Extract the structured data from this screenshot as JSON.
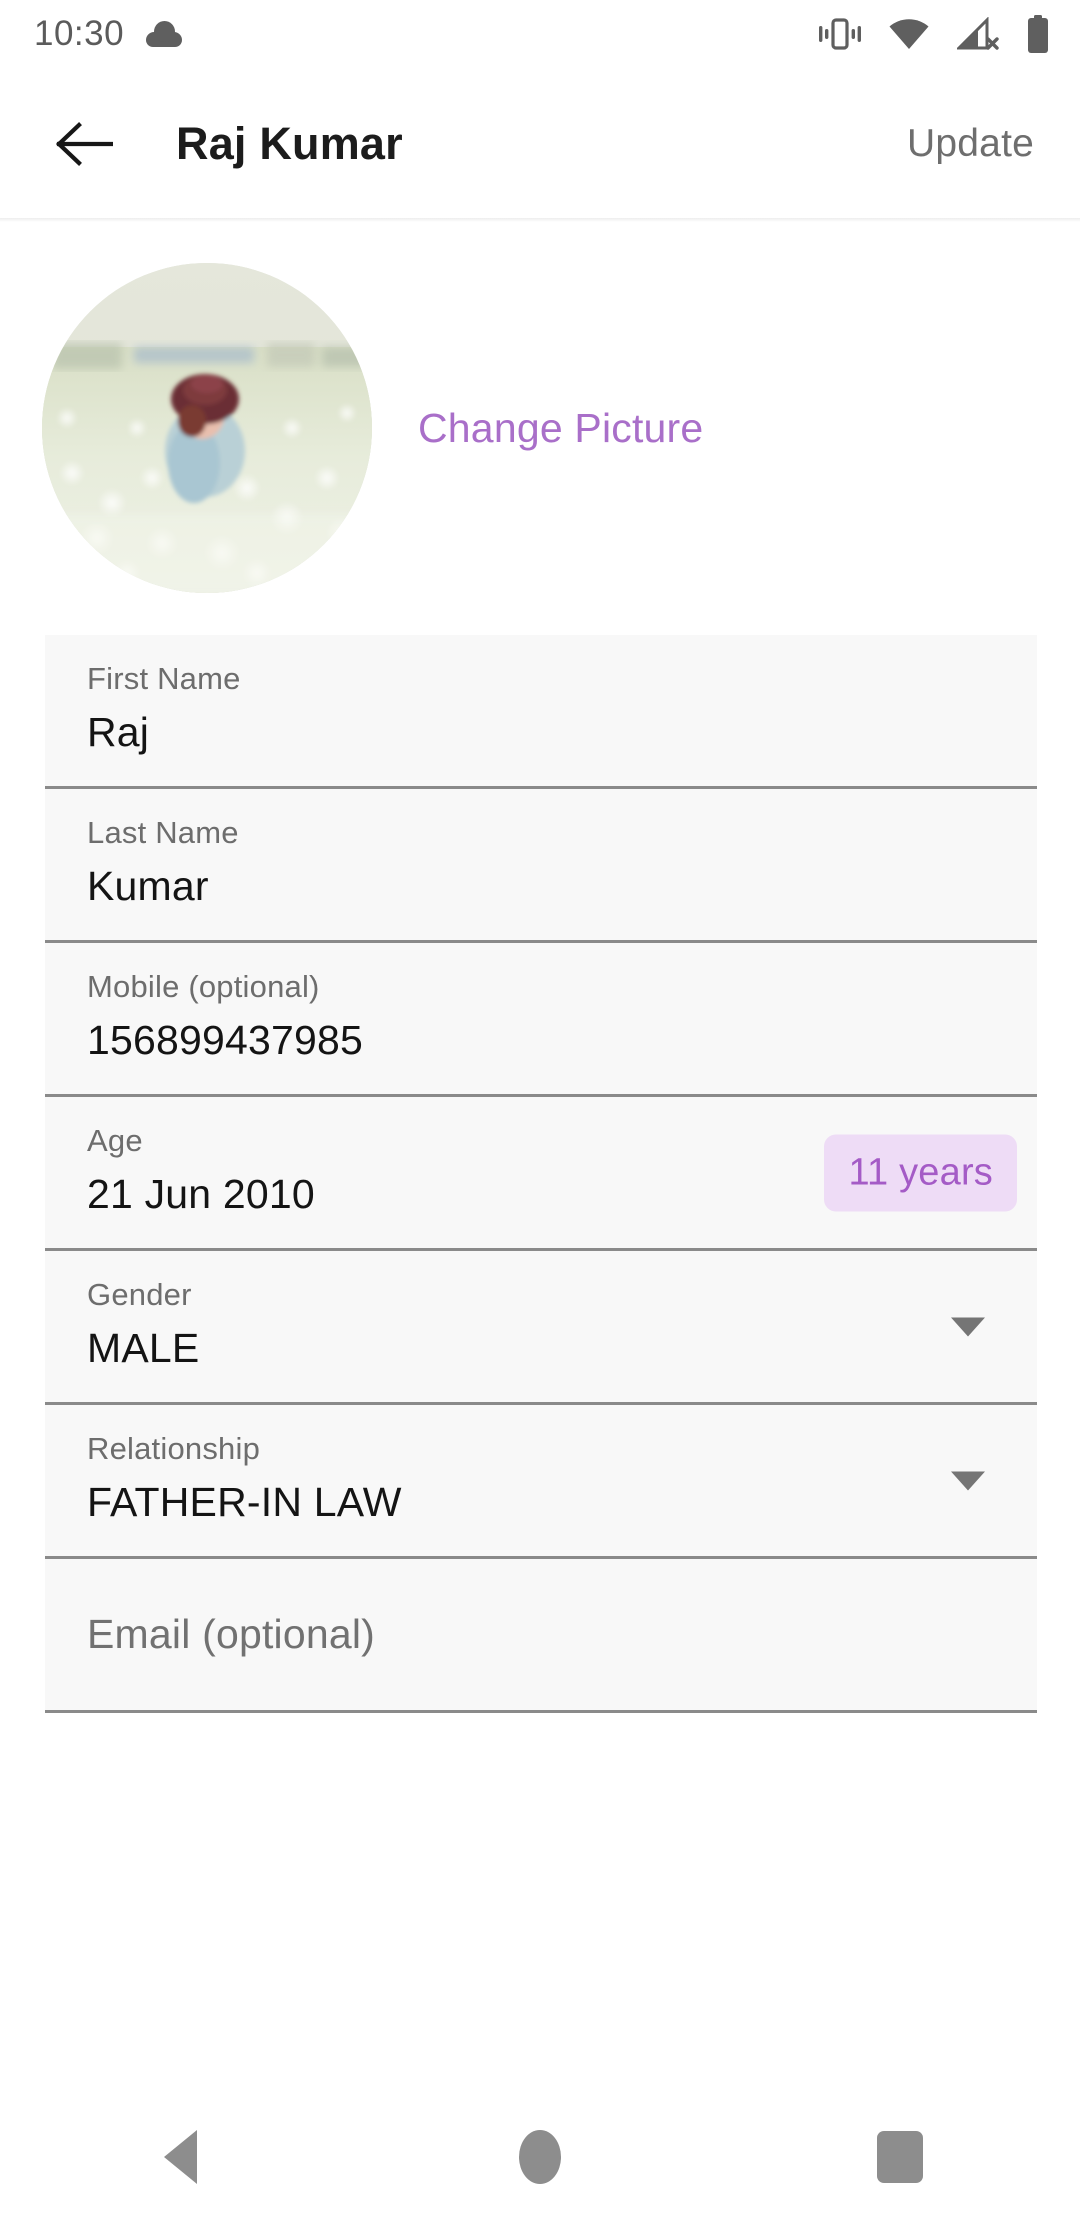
{
  "status_bar": {
    "time": "10:30",
    "left_icons": [
      "cloud-icon"
    ],
    "right_icons": [
      "vibrate-icon",
      "wifi-icon",
      "signal-no-service-icon",
      "battery-icon"
    ]
  },
  "appbar": {
    "back_icon": "arrow-left-icon",
    "title": "Raj Kumar",
    "action_label": "Update"
  },
  "profile": {
    "avatar_alt": "profile-photo",
    "change_picture_label": "Change Picture",
    "change_picture_color": "#a96fc9"
  },
  "form": {
    "fields": [
      {
        "name": "first-name",
        "label": "First Name",
        "value": "Raj",
        "type": "text"
      },
      {
        "name": "last-name",
        "label": "Last Name",
        "value": "Kumar",
        "type": "text"
      },
      {
        "name": "mobile",
        "label": "Mobile (optional)",
        "value": "156899437985",
        "type": "text"
      },
      {
        "name": "age",
        "label": "Age",
        "value": "21 Jun 2010",
        "type": "date",
        "badge": "11 years"
      },
      {
        "name": "gender",
        "label": "Gender",
        "value": "MALE",
        "type": "select"
      },
      {
        "name": "relationship",
        "label": "Relationship",
        "value": "FATHER-IN LAW",
        "type": "select"
      },
      {
        "name": "email",
        "label": "",
        "value": "",
        "type": "text",
        "placeholder": "Email (optional)"
      }
    ],
    "badge_bg_color": "#eedcf6",
    "badge_text_color": "#a45bc6",
    "field_bg_color": "#f8f8f8",
    "underline_color": "#8a8a8a"
  },
  "navbar": {
    "back_label": "back-triangle-icon",
    "home_label": "home-circle-icon",
    "recents_label": "recents-square-icon"
  }
}
